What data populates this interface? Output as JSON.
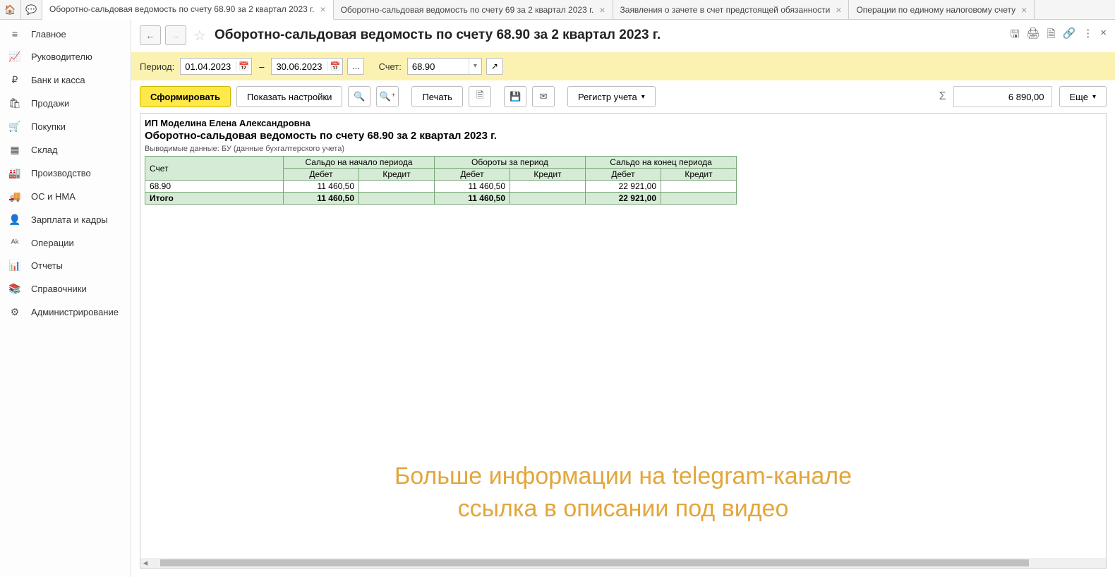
{
  "tabs": [
    {
      "label": "Оборотно-сальдовая ведомость по счету 68.90 за 2 квартал 2023 г.",
      "active": true
    },
    {
      "label": "Оборотно-сальдовая ведомость по счету 69 за 2 квартал 2023 г.",
      "active": false
    },
    {
      "label": "Заявления о зачете в счет предстоящей обязанности",
      "active": false
    },
    {
      "label": "Операции по единому налоговому счету",
      "active": false
    }
  ],
  "sidebar": [
    {
      "icon": "≡",
      "label": "Главное"
    },
    {
      "icon": "📈",
      "label": "Руководителю"
    },
    {
      "icon": "₽",
      "label": "Банк и касса"
    },
    {
      "icon": "🛍",
      "label": "Продажи"
    },
    {
      "icon": "🛒",
      "label": "Покупки"
    },
    {
      "icon": "▦",
      "label": "Склад"
    },
    {
      "icon": "🏭",
      "label": "Производство"
    },
    {
      "icon": "🚚",
      "label": "ОС и НМА"
    },
    {
      "icon": "👤",
      "label": "Зарплата и кадры"
    },
    {
      "icon": "ᴬᵏ",
      "label": "Операции"
    },
    {
      "icon": "📊",
      "label": "Отчеты"
    },
    {
      "icon": "📚",
      "label": "Справочники"
    },
    {
      "icon": "⚙",
      "label": "Администрирование"
    }
  ],
  "page_title": "Оборотно-сальдовая ведомость по счету 68.90 за 2 квартал 2023 г.",
  "filter": {
    "period_label": "Период:",
    "date_from": "01.04.2023",
    "date_to": "30.06.2023",
    "ellipsis": "...",
    "account_label": "Счет:",
    "account": "68.90"
  },
  "toolbar": {
    "form": "Сформировать",
    "settings": "Показать настройки",
    "print": "Печать",
    "register": "Регистр учета",
    "sum": "6 890,00",
    "more": "Еще"
  },
  "report": {
    "org": "ИП Моделина Елена Александровна",
    "title": "Оборотно-сальдовая ведомость по счету 68.90 за 2 квартал 2023 г.",
    "sub": "Выводимые данные: БУ (данные бухгалтерского учета)",
    "headers": {
      "account": "Счет",
      "open": "Сальдо на начало периода",
      "turn": "Обороты за период",
      "close": "Сальдо на конец периода",
      "debit": "Дебет",
      "credit": "Кредит"
    },
    "rows": [
      {
        "account": "68.90",
        "open_d": "11 460,50",
        "open_c": "",
        "turn_d": "11 460,50",
        "turn_c": "",
        "close_d": "22 921,00",
        "close_c": ""
      }
    ],
    "total_label": "Итого",
    "total": {
      "open_d": "11 460,50",
      "open_c": "",
      "turn_d": "11 460,50",
      "turn_c": "",
      "close_d": "22 921,00",
      "close_c": ""
    }
  },
  "watermark": {
    "l1": "Больше информации на telegram-канале",
    "l2": "ссылка в описании под видео"
  }
}
